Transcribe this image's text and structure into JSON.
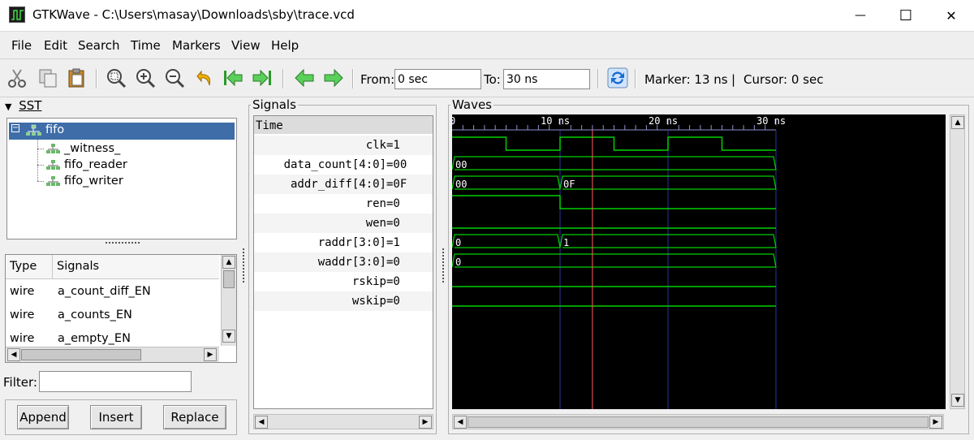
{
  "window": {
    "title": "GTKWave - C:\\Users\\masay\\Downloads\\sby\\trace.vcd",
    "minimize_glyph": "—",
    "maximize_glyph": "☐",
    "close_glyph": "✕"
  },
  "menu": [
    "File",
    "Edit",
    "Search",
    "Time",
    "Markers",
    "View",
    "Help"
  ],
  "toolbar": {
    "icons": [
      "cut-icon",
      "copy-icon",
      "paste-icon",
      "zoom-fit-icon",
      "zoom-in-icon",
      "zoom-out-icon",
      "undo-icon",
      "zoom-start-icon",
      "zoom-end-icon",
      "page-left-icon",
      "page-right-icon",
      "reload-icon"
    ],
    "from_label": "From:",
    "from_value": "0 sec",
    "to_label": "To:",
    "to_value": "30 ns",
    "marker_text": "Marker: 13 ns",
    "separator": "|",
    "cursor_text": "Cursor: 0 sec"
  },
  "sst": {
    "title": "SST",
    "tree": {
      "root": "fifo",
      "children": [
        "_witness_",
        "fifo_reader",
        "fifo_writer"
      ]
    },
    "list_headers": [
      "Type",
      "Signals"
    ],
    "list_rows": [
      {
        "type": "wire",
        "signal": "a_count_diff_EN"
      },
      {
        "type": "wire",
        "signal": "a_counts_EN"
      },
      {
        "type": "wire",
        "signal": "a_empty_EN"
      }
    ],
    "filter_label": "Filter:",
    "filter_value": "",
    "buttons": [
      "Append",
      "Insert",
      "Replace"
    ]
  },
  "signals": {
    "title": "Signals",
    "header": "Time",
    "rows": [
      {
        "name": "clk",
        "value": "=1"
      },
      {
        "name": "data_count[4:0]",
        "value": "=00"
      },
      {
        "name": "addr_diff[4:0]",
        "value": "=0F"
      },
      {
        "name": "ren",
        "value": "=0"
      },
      {
        "name": "wen",
        "value": "=0"
      },
      {
        "name": "raddr[3:0]",
        "value": "=1"
      },
      {
        "name": "waddr[3:0]",
        "value": "=0"
      },
      {
        "name": "rskip",
        "value": "=0"
      },
      {
        "name": "wskip",
        "value": "=0"
      }
    ]
  },
  "waves": {
    "title": "Waves",
    "ruler_labels": [
      "0",
      "10 ns",
      "20 ns",
      "30 ns"
    ],
    "ruler_times": [
      0,
      10,
      20,
      30
    ],
    "time_end": 30,
    "marker_time": 13,
    "colors": {
      "background": "#000000",
      "signal": "#00d000",
      "grid": "#3030a0",
      "marker": "#ff6060",
      "text": "#ffffff"
    },
    "traces": [
      {
        "kind": "bit",
        "init": 1,
        "edges": [
          5,
          10,
          15,
          20,
          25
        ],
        "labels": []
      },
      {
        "kind": "bus",
        "changes": [
          0
        ],
        "labels": [
          "00"
        ]
      },
      {
        "kind": "bus",
        "changes": [
          0,
          10
        ],
        "labels": [
          "00",
          "0F"
        ]
      },
      {
        "kind": "bit",
        "init": 1,
        "edges": [
          10
        ],
        "labels": []
      },
      {
        "kind": "bit",
        "init": 0,
        "edges": [],
        "labels": []
      },
      {
        "kind": "bus",
        "changes": [
          0,
          10
        ],
        "labels": [
          "0",
          "1"
        ]
      },
      {
        "kind": "bus",
        "changes": [
          0
        ],
        "labels": [
          "0"
        ]
      },
      {
        "kind": "bit",
        "init": 0,
        "edges": [],
        "labels": []
      },
      {
        "kind": "bit",
        "init": 0,
        "edges": [],
        "labels": []
      }
    ]
  }
}
